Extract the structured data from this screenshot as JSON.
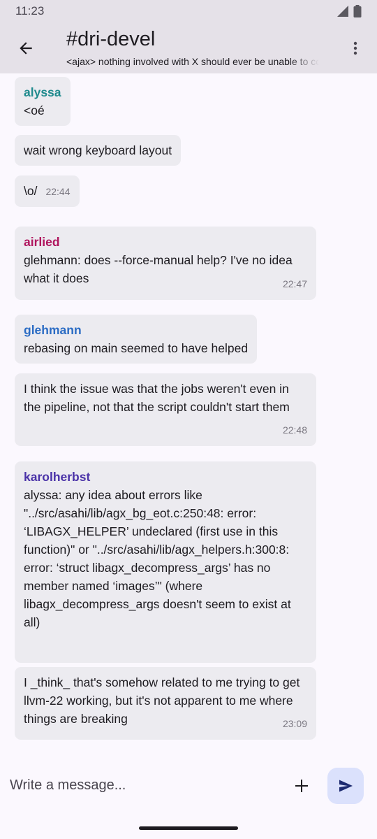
{
  "status_bar": {
    "time": "11:23",
    "icons": [
      "signal-icon",
      "battery-icon"
    ]
  },
  "header": {
    "title": "#dri-devel",
    "topic": "<ajax> nothing involved with X should ever be unable to cope with a DRI driver not being present",
    "back_icon": "arrow-back-icon",
    "menu_icon": "more-vert-icon"
  },
  "colors": {
    "alyssa": "#1f8a8d",
    "airlied": "#b0155e",
    "glehmann": "#2b6cc4",
    "karolherbst": "#4b33a8",
    "bubble": "#ecebf0",
    "header": "#e5e1e8",
    "send_button": "#dbe1fc",
    "send_icon": "#1c2a70"
  },
  "messages": [
    {
      "sender": "alyssa",
      "text": "<oé",
      "time": ""
    },
    {
      "sender": "",
      "text": "wait wrong keyboard layout",
      "time": ""
    },
    {
      "sender": "",
      "text": "\\o/",
      "time": "22:44"
    },
    {
      "sender": "airlied",
      "text": "glehmann: does --force-manual help? I've no idea what it does",
      "time": "22:47"
    },
    {
      "sender": "glehmann",
      "text": "rebasing on main seemed to have helped",
      "time": ""
    },
    {
      "sender": "",
      "text": "I think the issue was that the jobs weren't even in the pipeline, not that the script couldn't start them",
      "time": "22:48"
    },
    {
      "sender": "karolherbst",
      "text": "alyssa: any idea about errors like \"../src/asahi/lib/agx_bg_eot.c:250:48: error: ‘LIBAGX_HELPER’ undeclared (first use in this function)\" or \"../src/asahi/lib/agx_helpers.h:300:8: error: ‘struct libagx_decompress_args’ has no member named ‘images’\" (where libagx_decompress_args doesn't seem to exist at all)",
      "time": ""
    },
    {
      "sender": "",
      "text": "I _think_ that's somehow related to me trying to get llvm-22 working, but it's not apparent to me where things are breaking",
      "time": "23:09"
    }
  ],
  "composer": {
    "placeholder": "Write a message...",
    "add_icon": "plus-icon",
    "send_icon": "send-icon"
  }
}
